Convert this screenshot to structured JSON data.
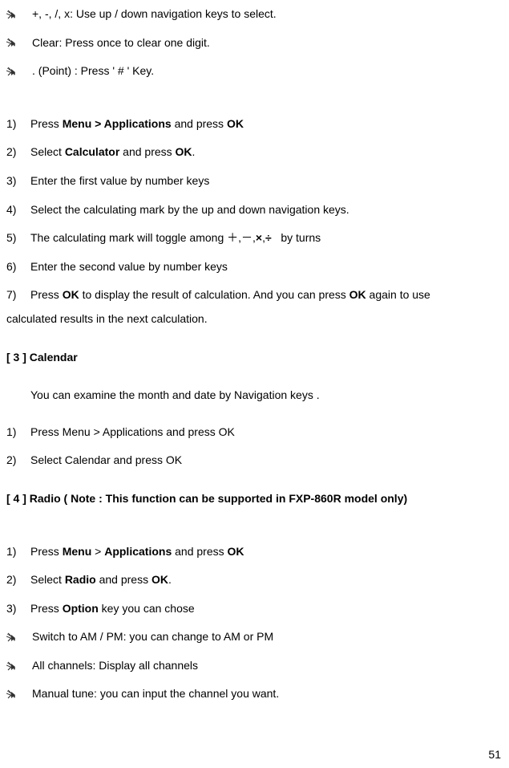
{
  "tips": [
    "+, -, /, x: Use up / down navigation keys to select.",
    " Clear: Press once to clear one digit.",
    " . (Point) : Press ' # ' Key."
  ],
  "calc_steps": {
    "s1_a": "Press ",
    "s1_b": "Menu > Applications",
    "s1_c": " and press ",
    "s1_d": "OK",
    "s2_a": "Select ",
    "s2_b": "Calculator",
    "s2_c": " and press ",
    "s2_d": "OK",
    "s2_e": ".",
    "s3": "Enter the first value by number keys",
    "s4": "Select the calculating mark by the up and down    navigation keys.",
    "s5": "The calculating mark will toggle among ＋,＋,－,×,÷   by turns",
    "s6": "Enter the second value by number keys",
    "s7_a": "Press ",
    "s7_b": "OK",
    "s7_c": " to display the result of calculation. And you can press ",
    "s7_d": "OK",
    "s7_e": " again to use",
    "s7_cont": "calculated results in the next calculation."
  },
  "headings": {
    "calendar": "[ 3 ]    Calendar",
    "radio": "[ 4 ]    Radio ( Note : This function can be supported in FXP-860R model only)"
  },
  "calendar_para": "You can examine the month and date by Navigation keys .",
  "cal_steps": {
    "s1": "Press Menu > Applications and press OK",
    "s2": "Select Calendar and press OK"
  },
  "radio_steps": {
    "s1_a": "Press ",
    "s1_b": "Menu",
    "s1_c": " > ",
    "s1_d": "Applications",
    "s1_e": " and press ",
    "s1_f": "OK",
    "s2_a": "Select ",
    "s2_b": "Radio",
    "s2_c": " and press ",
    "s2_d": "OK",
    "s2_e": ".",
    "s3_a": "Press ",
    "s3_b": "Option",
    "s3_c": " key you can chose"
  },
  "radio_bullets": [
    " Switch to AM / PM: you can change to AM or PM",
    " All channels: Display all channels",
    " Manual tune: you can input the channel you want."
  ],
  "page_number": "51"
}
